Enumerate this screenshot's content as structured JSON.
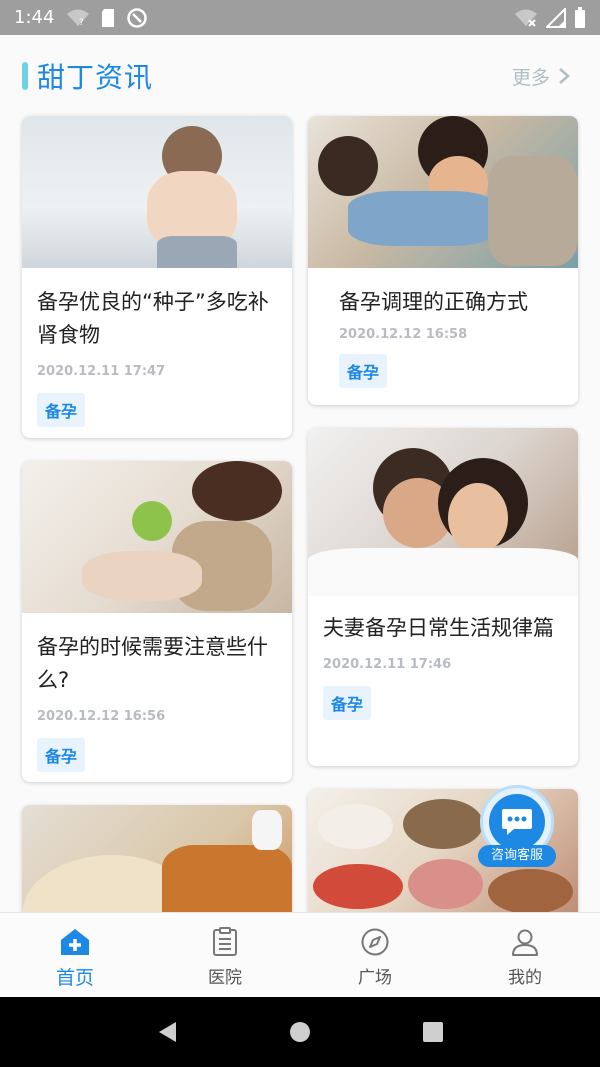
{
  "status_bar": {
    "time": "1:44"
  },
  "section": {
    "title": "甜丁资讯",
    "more_label": "更多"
  },
  "articles": [
    {
      "title": "备孕优良的“种子”多吃补肾食物",
      "date": "2020.12.11 17:47",
      "tag": "备孕"
    },
    {
      "title": "备孕调理的正确方式",
      "date": "2020.12.12 16:58",
      "tag": "备孕"
    },
    {
      "title": "备孕的时候需要注意些什么?",
      "date": "2020.12.12 16:56",
      "tag": "备孕"
    },
    {
      "title": "夫妻备孕日常生活规律篇",
      "date": "2020.12.11 17:46",
      "tag": "备孕"
    }
  ],
  "consult": {
    "label": "咨询客服"
  },
  "tabs": [
    {
      "label": "首页",
      "icon": "home-plus-icon",
      "active": true
    },
    {
      "label": "医院",
      "icon": "clipboard-icon",
      "active": false
    },
    {
      "label": "广场",
      "icon": "compass-icon",
      "active": false
    },
    {
      "label": "我的",
      "icon": "person-icon",
      "active": false
    }
  ],
  "colors": {
    "accent": "#1e88e5",
    "status_bar": "#9e9e9e",
    "tag_bg": "#e8f3fd"
  }
}
